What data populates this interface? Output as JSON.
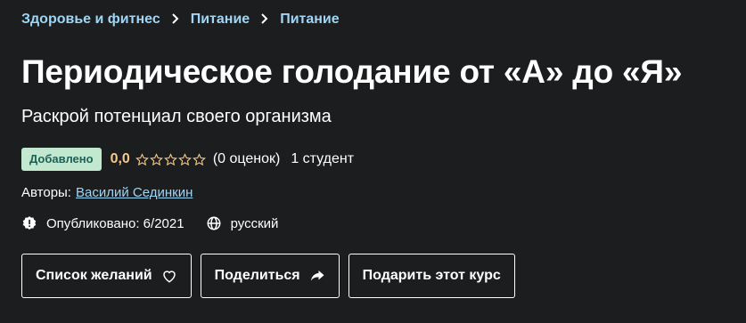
{
  "breadcrumb": [
    "Здоровье и фитнес",
    "Питание",
    "Питание"
  ],
  "title": "Периодическое голодание от «А» до «Я»",
  "subtitle": "Раскрой потенциал своего организма",
  "rating": {
    "badge": "Добавлено",
    "score": "0,0",
    "stars_filled": 0,
    "stars_total": 5,
    "count": "(0 оценок)",
    "students": "1 студент"
  },
  "authors": {
    "label": "Авторы:",
    "name": "Василий Сединкин"
  },
  "meta": {
    "published": "Опубликовано: 6/2021",
    "language": "русский"
  },
  "buttons": {
    "wishlist": "Список желаний",
    "share": "Поделиться",
    "gift": "Подарить этот курс"
  },
  "colors": {
    "background": "#1c1d1f",
    "link": "#9fd6f5",
    "star": "#f3ca8c",
    "badge_bg": "#c2e8d0"
  },
  "icons": [
    "chevron-right-icon",
    "star-outline-icon",
    "alert-badge-icon",
    "globe-icon",
    "heart-outline-icon",
    "share-arrow-icon"
  ]
}
